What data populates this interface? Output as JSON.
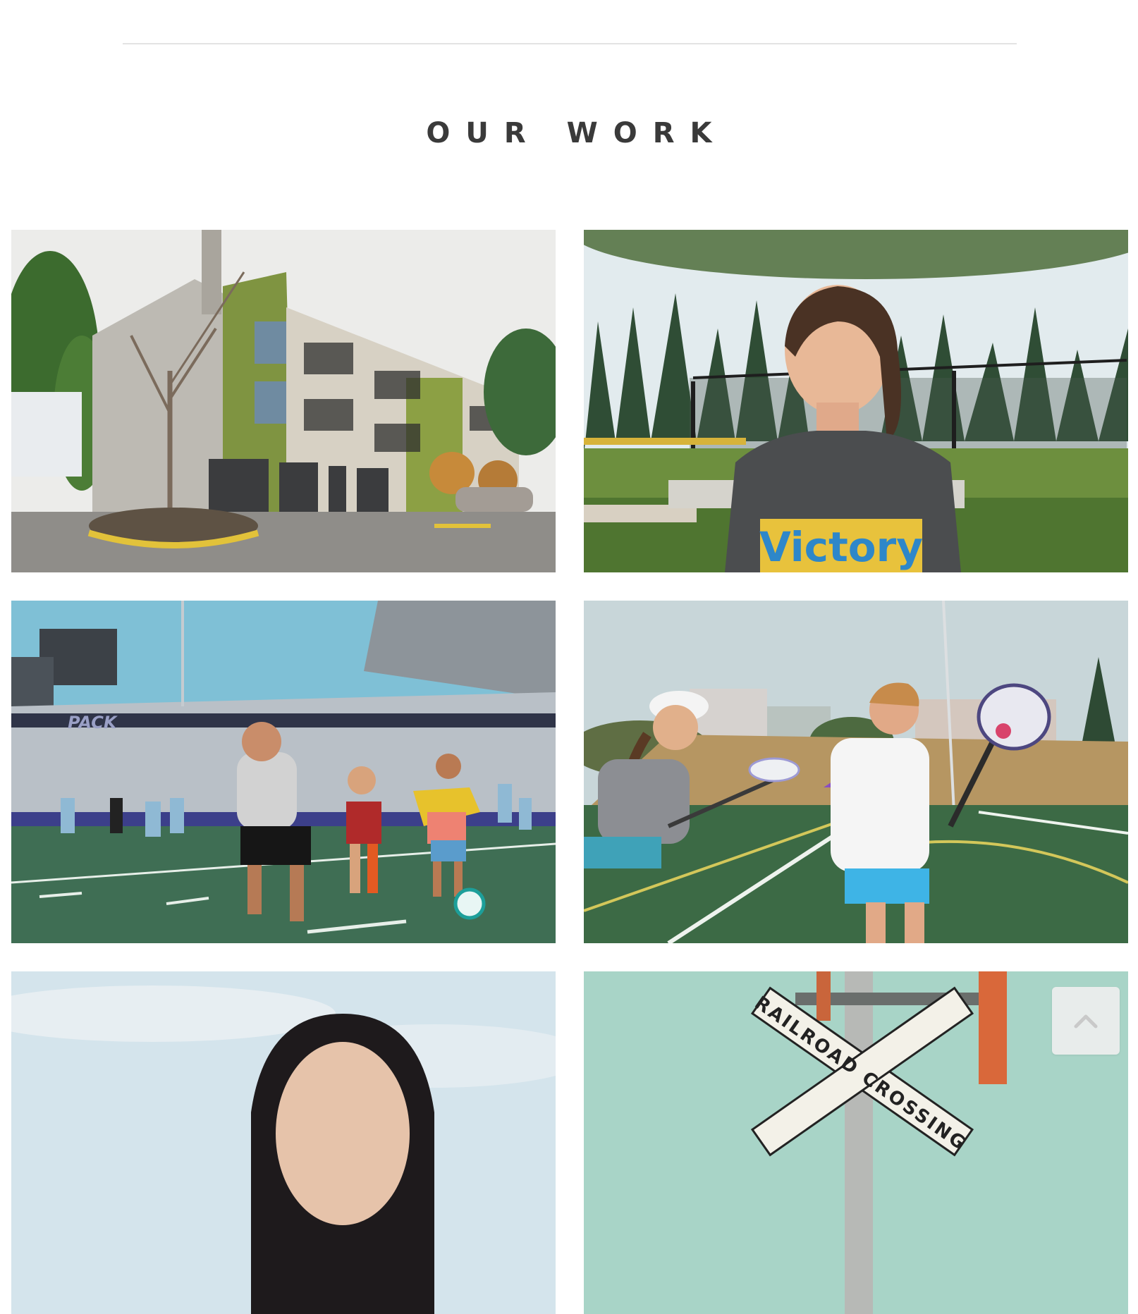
{
  "section": {
    "title": "OUR WORK"
  },
  "projects": [
    {
      "subject": "apartment-building",
      "icon": "image"
    },
    {
      "subject": "athlete-interview",
      "icon": "image",
      "shirt_text": "Victory"
    },
    {
      "subject": "kids-soccer-stadium",
      "icon": "image",
      "banner_text": "PACK"
    },
    {
      "subject": "kids-lacrosse",
      "icon": "image"
    },
    {
      "subject": "portrait-woman",
      "icon": "image"
    },
    {
      "subject": "railroad-crossing-sign",
      "icon": "image",
      "sign_text": "RAILROAD CROSSING"
    }
  ],
  "scroll_top": {
    "icon": "chevron-up-icon"
  },
  "colors": {
    "title": "#3a3a3a",
    "divider": "#e3e3e3",
    "scroll_button_bg": "#eeeeee",
    "scroll_chevron": "#c9c9c9"
  }
}
